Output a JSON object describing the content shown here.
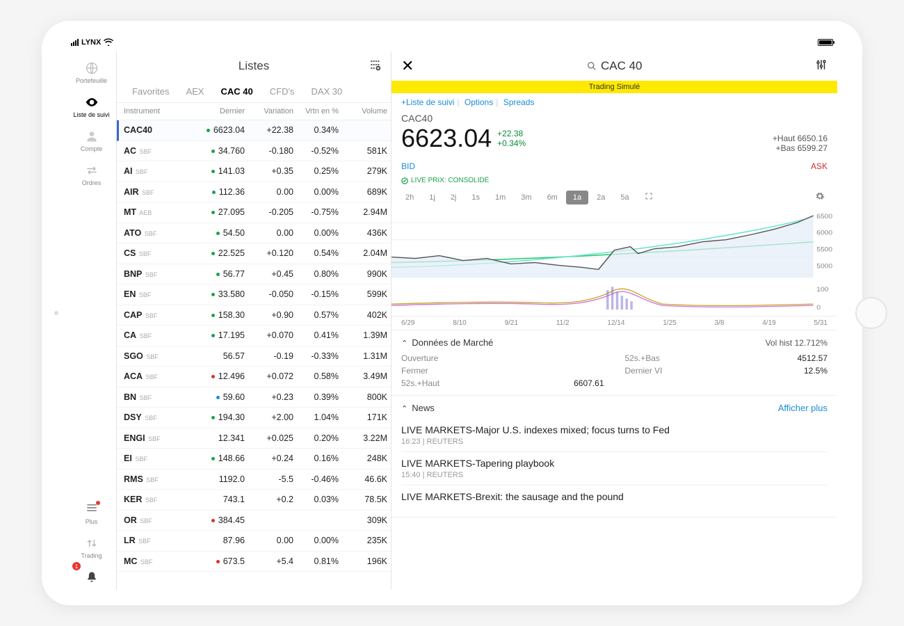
{
  "status": {
    "carrier": "LYNX"
  },
  "rail": {
    "portfolio": "Portefeuille",
    "watchlist": "Liste de suivi",
    "account": "Compte",
    "orders": "Ordres",
    "more": "Plus",
    "trading": "Trading",
    "alertCount": "1"
  },
  "lists": {
    "title": "Listes",
    "tabs": [
      "Favorites",
      "AEX",
      "CAC 40",
      "CFD's",
      "DAX 30"
    ],
    "activeTab": 2,
    "columns": {
      "instrument": "Instrument",
      "last": "Dernier",
      "chg": "Variation",
      "pct": "Vrtn en %",
      "vol": "Volume"
    },
    "rows": [
      {
        "sym": "CAC40",
        "ex": "",
        "dot": "g",
        "last": "6623.04",
        "chg": "+22.38",
        "pct": "0.34%",
        "vol": "",
        "dir": "pos",
        "sel": true
      },
      {
        "sym": "AC",
        "ex": "SBF",
        "dot": "g",
        "last": "34.760",
        "chg": "-0.180",
        "pct": "-0.52%",
        "vol": "581K",
        "dir": "neg"
      },
      {
        "sym": "AI",
        "ex": "SBF",
        "dot": "g",
        "last": "141.03",
        "chg": "+0.35",
        "pct": "0.25%",
        "vol": "279K",
        "dir": "pos"
      },
      {
        "sym": "AIR",
        "ex": "SBF",
        "dot": "g",
        "last": "112.36",
        "chg": "0.00",
        "pct": "0.00%",
        "vol": "689K",
        "dir": "pos"
      },
      {
        "sym": "MT",
        "ex": "AEB",
        "dot": "g",
        "last": "27.095",
        "chg": "-0.205",
        "pct": "-0.75%",
        "vol": "2.94M",
        "dir": "neg"
      },
      {
        "sym": "ATO",
        "ex": "SBF",
        "dot": "g",
        "last": "54.50",
        "chg": "0.00",
        "pct": "0.00%",
        "vol": "436K",
        "dir": "pos"
      },
      {
        "sym": "CS",
        "ex": "SBF",
        "dot": "g",
        "last": "22.525",
        "chg": "+0.120",
        "pct": "0.54%",
        "vol": "2.04M",
        "dir": "pos"
      },
      {
        "sym": "BNP",
        "ex": "SBF",
        "dot": "g",
        "last": "56.77",
        "chg": "+0.45",
        "pct": "0.80%",
        "vol": "990K",
        "dir": "pos"
      },
      {
        "sym": "EN",
        "ex": "SBF",
        "dot": "g",
        "last": "33.580",
        "chg": "-0.050",
        "pct": "-0.15%",
        "vol": "599K",
        "dir": "neg"
      },
      {
        "sym": "CAP",
        "ex": "SBF",
        "dot": "g",
        "last": "158.30",
        "chg": "+0.90",
        "pct": "0.57%",
        "vol": "402K",
        "dir": "pos"
      },
      {
        "sym": "CA",
        "ex": "SBF",
        "dot": "g",
        "last": "17.195",
        "chg": "+0.070",
        "pct": "0.41%",
        "vol": "1.39M",
        "dir": "pos"
      },
      {
        "sym": "SGO",
        "ex": "SBF",
        "dot": "",
        "last": "56.57",
        "chg": "-0.19",
        "pct": "-0.33%",
        "vol": "1.31M",
        "dir": "neg"
      },
      {
        "sym": "ACA",
        "ex": "SBF",
        "dot": "r",
        "last": "12.496",
        "chg": "+0.072",
        "pct": "0.58%",
        "vol": "3.49M",
        "dir": "pos"
      },
      {
        "sym": "BN",
        "ex": "SBF",
        "dot": "b",
        "last": "59.60",
        "chg": "+0.23",
        "pct": "0.39%",
        "vol": "800K",
        "dir": "pos"
      },
      {
        "sym": "DSY",
        "ex": "SBF",
        "dot": "g",
        "last": "194.30",
        "chg": "+2.00",
        "pct": "1.04%",
        "vol": "171K",
        "dir": "pos"
      },
      {
        "sym": "ENGI",
        "ex": "SBF",
        "dot": "",
        "last": "12.341",
        "chg": "+0.025",
        "pct": "0.20%",
        "vol": "3.22M",
        "dir": "pos"
      },
      {
        "sym": "EI",
        "ex": "SBF",
        "dot": "g",
        "last": "148.66",
        "chg": "+0.24",
        "pct": "0.16%",
        "vol": "248K",
        "dir": "pos"
      },
      {
        "sym": "RMS",
        "ex": "SBF",
        "dot": "",
        "last": "1192.0",
        "chg": "-5.5",
        "pct": "-0.46%",
        "vol": "46.6K",
        "dir": "neg"
      },
      {
        "sym": "KER",
        "ex": "SBF",
        "dot": "",
        "last": "743.1",
        "chg": "+0.2",
        "pct": "0.03%",
        "vol": "78.5K",
        "dir": "pos"
      },
      {
        "sym": "OR",
        "ex": "SBF",
        "dot": "r",
        "last": "384.45",
        "chg": "",
        "pct": "",
        "vol": "309K",
        "dir": ""
      },
      {
        "sym": "LR",
        "ex": "SBF",
        "dot": "",
        "last": "87.96",
        "chg": "0.00",
        "pct": "0.00%",
        "vol": "235K",
        "dir": "pos"
      },
      {
        "sym": "MC",
        "ex": "SBF",
        "dot": "r",
        "last": "673.5",
        "chg": "+5.4",
        "pct": "0.81%",
        "vol": "196K",
        "dir": "pos"
      }
    ]
  },
  "detail": {
    "searchHint": "CAC 40",
    "simulated": "Trading Simulé",
    "tabs": {
      "watch": "+Liste de suivi",
      "options": "Options",
      "spreads": "Spreads"
    },
    "symbol": "CAC40",
    "price": "6623.04",
    "chgAbs": "+22.38",
    "chgPct": "+0.34%",
    "high": {
      "label": "+Haut",
      "value": "6650.16"
    },
    "low": {
      "label": "+Bas",
      "value": "6599.27"
    },
    "bid": "BID",
    "ask": "ASK",
    "live": "LIVE PRIX: CONSOLIDÉ",
    "ranges": [
      "2h",
      "1j",
      "2j",
      "1s",
      "1m",
      "3m",
      "6m",
      "1a",
      "2a",
      "5a"
    ],
    "activeRange": 7,
    "xaxis": [
      "6/29",
      "8/10",
      "9/21",
      "11/2",
      "12/14",
      "1/25",
      "3/8",
      "4/19",
      "5/31"
    ],
    "yaxisPrice": [
      "6500",
      "6000",
      "5500",
      "5000"
    ],
    "yaxisVol": [
      "100",
      "0"
    ],
    "market": {
      "title": "Données de Marché",
      "volHistLabel": "Vol hist",
      "volHist": "12.712%",
      "open": "Ouverture",
      "openV": "",
      "close": "Fermer",
      "closeV": "",
      "h52": "52s.+Haut",
      "h52V": "6607.61",
      "l52": "52s.+Bas",
      "l52V": "4512.57",
      "lastVI": "Dernier VI",
      "lastVIV": "12.5%"
    },
    "news": {
      "title": "News",
      "more": "Afficher plus",
      "items": [
        {
          "h": "LIVE MARKETS-Major U.S. indexes mixed; focus turns to Fed",
          "m": "16:23 | REUTERS"
        },
        {
          "h": "LIVE MARKETS-Tapering playbook",
          "m": "15:40 | REUTERS"
        },
        {
          "h": "LIVE MARKETS-Brexit: the sausage and the pound",
          "m": ""
        }
      ]
    }
  },
  "chart_data": {
    "type": "line",
    "title": "CAC40 · 1a",
    "xlabel": "",
    "ylabel": "",
    "x": [
      "6/29",
      "8/10",
      "9/21",
      "11/2",
      "12/14",
      "1/25",
      "3/8",
      "4/19",
      "5/31"
    ],
    "ylim": [
      4500,
      6700
    ],
    "series": [
      {
        "name": "price",
        "values": [
          4900,
          4950,
          4800,
          4700,
          5500,
          5550,
          5900,
          6200,
          6600
        ]
      },
      {
        "name": "ma-fast",
        "values": [
          4800,
          4900,
          4950,
          4900,
          5100,
          5300,
          5600,
          5900,
          6300
        ]
      },
      {
        "name": "ma-slow",
        "values": [
          4700,
          4800,
          4850,
          4900,
          5000,
          5150,
          5300,
          5450,
          5600
        ]
      }
    ],
    "volume": [
      30,
      40,
      35,
      50,
      90,
      45,
      40,
      35,
      30
    ]
  }
}
